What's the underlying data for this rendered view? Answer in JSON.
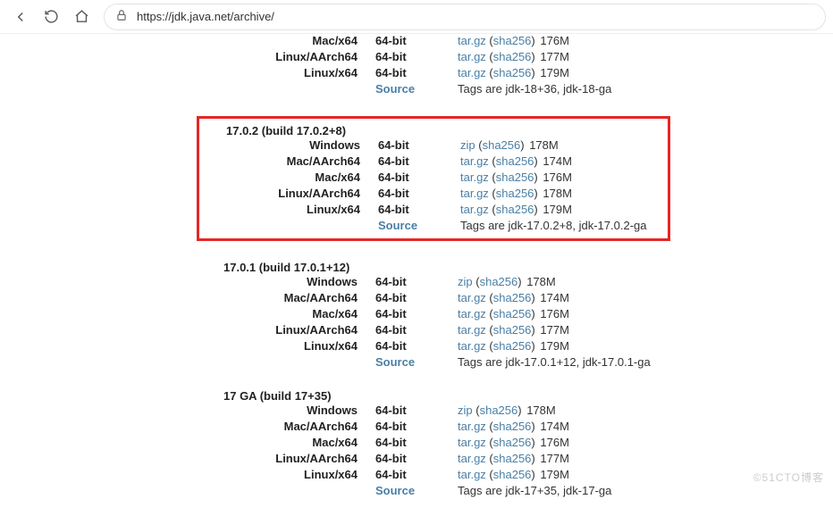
{
  "url": "https://jdk.java.net/archive/",
  "watermark": "©51CTO博客",
  "topRows": [
    {
      "platform": "Mac/x64",
      "arch": "64-bit",
      "file": "tar.gz",
      "hash": "sha256",
      "size": "176M"
    },
    {
      "platform": "Linux/AArch64",
      "arch": "64-bit",
      "file": "tar.gz",
      "hash": "sha256",
      "size": "177M"
    },
    {
      "platform": "Linux/x64",
      "arch": "64-bit",
      "file": "tar.gz",
      "hash": "sha256",
      "size": "179M"
    }
  ],
  "topSource": {
    "label": "Source",
    "tags": "Tags are jdk-18+36, jdk-18-ga"
  },
  "sections": [
    {
      "version": "17.0.2 (build 17.0.2+8)",
      "highlight": true,
      "rows": [
        {
          "platform": "Windows",
          "arch": "64-bit",
          "file": "zip",
          "hash": "sha256",
          "size": "178M"
        },
        {
          "platform": "Mac/AArch64",
          "arch": "64-bit",
          "file": "tar.gz",
          "hash": "sha256",
          "size": "174M"
        },
        {
          "platform": "Mac/x64",
          "arch": "64-bit",
          "file": "tar.gz",
          "hash": "sha256",
          "size": "176M"
        },
        {
          "platform": "Linux/AArch64",
          "arch": "64-bit",
          "file": "tar.gz",
          "hash": "sha256",
          "size": "178M"
        },
        {
          "platform": "Linux/x64",
          "arch": "64-bit",
          "file": "tar.gz",
          "hash": "sha256",
          "size": "179M"
        }
      ],
      "source": {
        "label": "Source",
        "tags": "Tags are jdk-17.0.2+8, jdk-17.0.2-ga"
      }
    },
    {
      "version": "17.0.1 (build 17.0.1+12)",
      "highlight": false,
      "rows": [
        {
          "platform": "Windows",
          "arch": "64-bit",
          "file": "zip",
          "hash": "sha256",
          "size": "178M"
        },
        {
          "platform": "Mac/AArch64",
          "arch": "64-bit",
          "file": "tar.gz",
          "hash": "sha256",
          "size": "174M"
        },
        {
          "platform": "Mac/x64",
          "arch": "64-bit",
          "file": "tar.gz",
          "hash": "sha256",
          "size": "176M"
        },
        {
          "platform": "Linux/AArch64",
          "arch": "64-bit",
          "file": "tar.gz",
          "hash": "sha256",
          "size": "177M"
        },
        {
          "platform": "Linux/x64",
          "arch": "64-bit",
          "file": "tar.gz",
          "hash": "sha256",
          "size": "179M"
        }
      ],
      "source": {
        "label": "Source",
        "tags": "Tags are jdk-17.0.1+12, jdk-17.0.1-ga"
      }
    },
    {
      "version": "17 GA (build 17+35)",
      "highlight": false,
      "rows": [
        {
          "platform": "Windows",
          "arch": "64-bit",
          "file": "zip",
          "hash": "sha256",
          "size": "178M"
        },
        {
          "platform": "Mac/AArch64",
          "arch": "64-bit",
          "file": "tar.gz",
          "hash": "sha256",
          "size": "174M"
        },
        {
          "platform": "Mac/x64",
          "arch": "64-bit",
          "file": "tar.gz",
          "hash": "sha256",
          "size": "176M"
        },
        {
          "platform": "Linux/AArch64",
          "arch": "64-bit",
          "file": "tar.gz",
          "hash": "sha256",
          "size": "177M"
        },
        {
          "platform": "Linux/x64",
          "arch": "64-bit",
          "file": "tar.gz",
          "hash": "sha256",
          "size": "179M"
        }
      ],
      "source": {
        "label": "Source",
        "tags": "Tags are jdk-17+35, jdk-17-ga"
      }
    }
  ]
}
